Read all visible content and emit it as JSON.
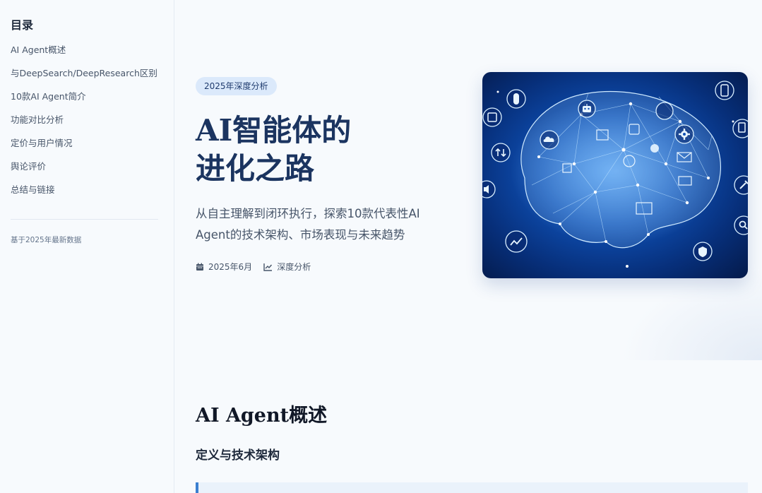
{
  "sidebar": {
    "title": "目录",
    "items": [
      {
        "label": "AI Agent概述"
      },
      {
        "label": "与DeepSearch/DeepResearch区别"
      },
      {
        "label": "10款AI Agent简介"
      },
      {
        "label": "功能对比分析"
      },
      {
        "label": "定价与用户情况"
      },
      {
        "label": "舆论评价"
      },
      {
        "label": "总结与链接"
      }
    ],
    "note": "基于2025年最新数据"
  },
  "hero": {
    "badge": "2025年深度分析",
    "title_line1": "AI智能体的",
    "title_line2": "进化之路",
    "subtitle": "从自主理解到闭环执行，探索10款代表性AI Agent的技术架构、市场表现与未来趋势",
    "meta": {
      "date": "2025年6月",
      "date_icon": "calendar-icon",
      "category": "深度分析",
      "category_icon": "chart-line-icon"
    },
    "image_icons": [
      "brain-network",
      "robot-icon",
      "gear-icon",
      "chip-icon",
      "shield-icon",
      "chart-icon",
      "mail-icon",
      "cloud-icon",
      "search-icon",
      "tools-icon"
    ]
  },
  "section": {
    "title": "AI Agent概述",
    "subtitle": "定义与技术架构"
  },
  "colors": {
    "accent": "#3b7fd0",
    "title": "#1b3460",
    "badge_bg": "#dbe9fb"
  }
}
